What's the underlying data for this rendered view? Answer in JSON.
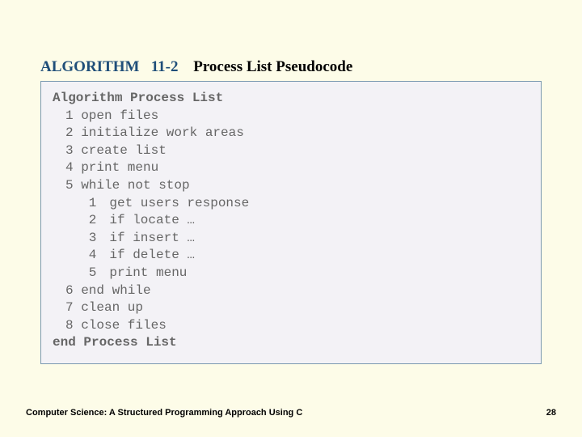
{
  "header": {
    "label": "ALGORITHM",
    "number": "11-2",
    "title": "Process List Pseudocode"
  },
  "code": {
    "algName": "Algorithm Process List",
    "lines": [
      {
        "n": "1",
        "text": "open files"
      },
      {
        "n": "2",
        "text": "initialize work areas"
      },
      {
        "n": "3",
        "text": "create list"
      },
      {
        "n": "4",
        "text": "print menu"
      },
      {
        "n": "5",
        "text": "while not stop"
      }
    ],
    "sublines": [
      {
        "n": "1",
        "text": "get users response"
      },
      {
        "n": "2",
        "text": "if locate …"
      },
      {
        "n": "3",
        "text": "if insert …"
      },
      {
        "n": "4",
        "text": "if delete …"
      },
      {
        "n": "5",
        "text": "print menu"
      }
    ],
    "lines2": [
      {
        "n": "6",
        "text": "end while"
      },
      {
        "n": "7",
        "text": "clean up"
      },
      {
        "n": "8",
        "text": "close files"
      }
    ],
    "endAlg": "end Process List"
  },
  "footer": {
    "left": "Computer Science: A Structured Programming Approach Using C",
    "right": "28"
  }
}
